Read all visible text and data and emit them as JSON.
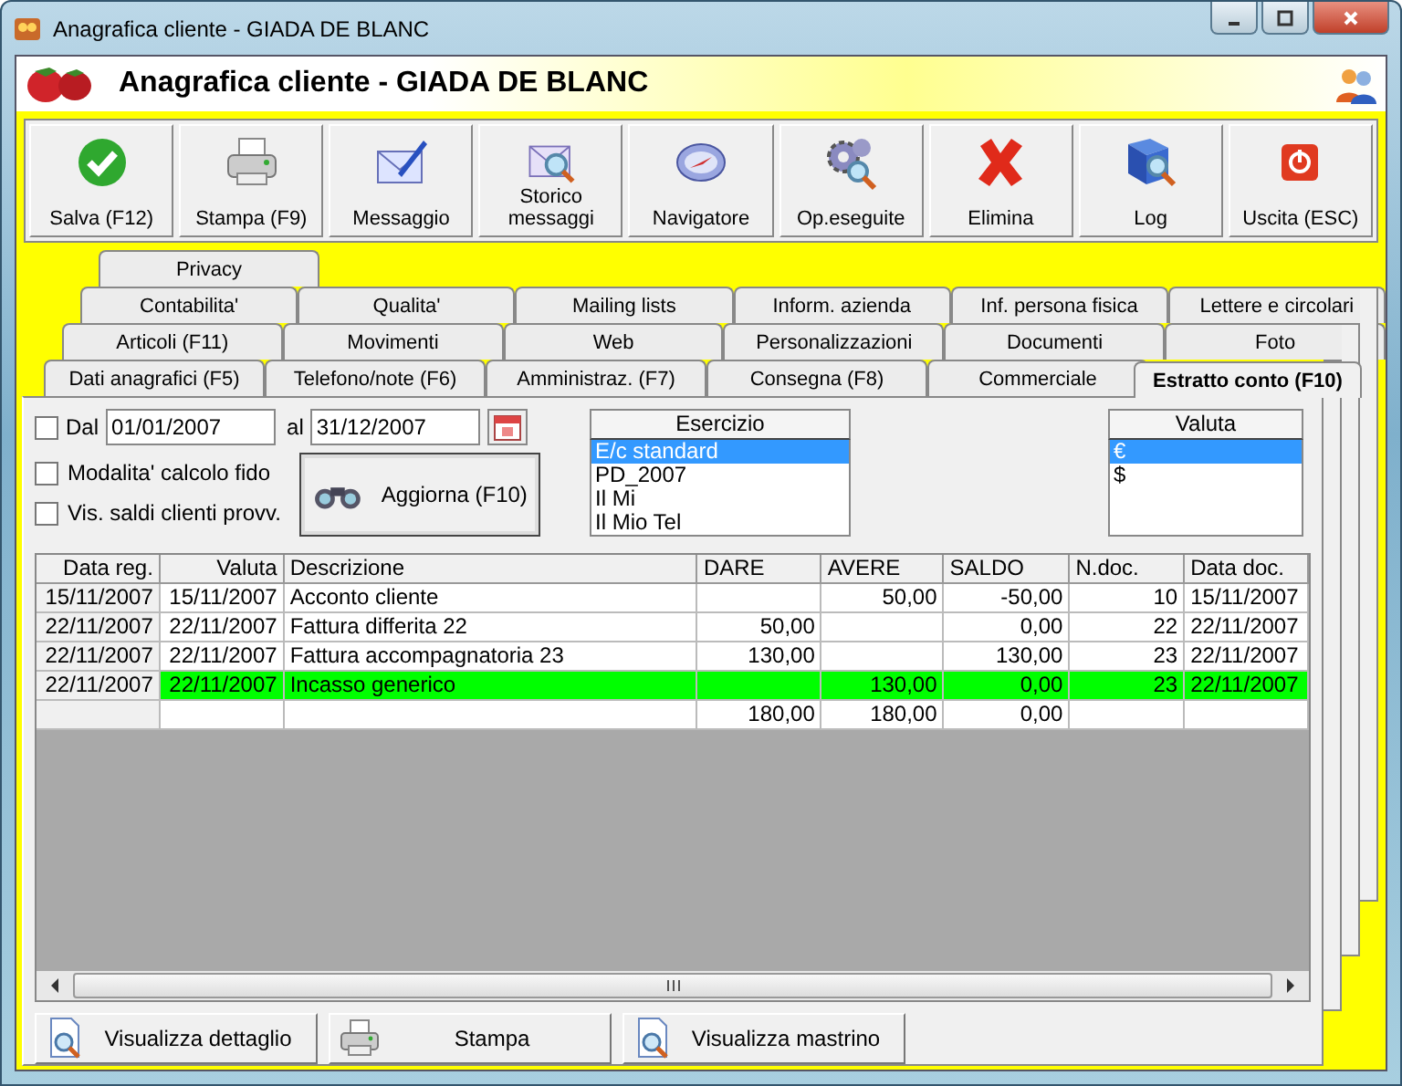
{
  "window": {
    "title": "Anagrafica cliente - GIADA DE BLANC"
  },
  "header": {
    "title": "Anagrafica cliente - GIADA DE BLANC"
  },
  "toolbar": [
    {
      "label": "Salva (F12)"
    },
    {
      "label": "Stampa (F9)"
    },
    {
      "label": "Messaggio"
    },
    {
      "label": "Storico messaggi"
    },
    {
      "label": "Navigatore"
    },
    {
      "label": "Op.eseguite"
    },
    {
      "label": "Elimina"
    },
    {
      "label": "Log"
    },
    {
      "label": "Uscita (ESC)"
    }
  ],
  "tab_rows": [
    [
      {
        "label": "Privacy",
        "selected": false
      }
    ],
    [
      {
        "label": "Contabilita'",
        "selected": false
      },
      {
        "label": "Qualita'",
        "selected": false
      },
      {
        "label": "Mailing lists",
        "selected": false
      },
      {
        "label": "Inform. azienda",
        "selected": false
      },
      {
        "label": "Inf. persona fisica",
        "selected": false
      },
      {
        "label": "Lettere e circolari",
        "selected": false
      }
    ],
    [
      {
        "label": "Articoli (F11)",
        "selected": false
      },
      {
        "label": "Movimenti",
        "selected": false
      },
      {
        "label": "Web",
        "selected": false
      },
      {
        "label": "Personalizzazioni",
        "selected": false
      },
      {
        "label": "Documenti",
        "selected": false
      },
      {
        "label": "Foto",
        "selected": false
      }
    ],
    [
      {
        "label": "Dati anagrafici (F5)",
        "selected": false
      },
      {
        "label": "Telefono/note (F6)",
        "selected": false
      },
      {
        "label": "Amministraz. (F7)",
        "selected": false
      },
      {
        "label": "Consegna (F8)",
        "selected": false
      },
      {
        "label": "Commerciale",
        "selected": false
      },
      {
        "label": "Estratto conto (F10)",
        "selected": true
      }
    ]
  ],
  "filters": {
    "from": {
      "label": "Dal",
      "checked": false,
      "value": "01/01/2007"
    },
    "to": {
      "label": "al",
      "value": "31/12/2007"
    },
    "options": [
      {
        "label": "Modalita' calcolo fido",
        "checked": false
      },
      {
        "label": "Vis. saldi clienti provv.",
        "checked": false
      }
    ],
    "refresh_button": "Aggiorna (F10)"
  },
  "esercizio": {
    "header": "Esercizio",
    "items": [
      {
        "label": "E/c standard",
        "selected": true
      },
      {
        "label": "PD_2007",
        "selected": false
      },
      {
        "label": "Il Mi",
        "selected": false
      },
      {
        "label": "Il Mio Tel",
        "selected": false
      }
    ]
  },
  "valuta": {
    "header": "Valuta",
    "items": [
      {
        "label": "€",
        "selected": true
      },
      {
        "label": "$",
        "selected": false
      }
    ]
  },
  "table": {
    "columns": [
      "Data reg.",
      "Valuta",
      "Descrizione",
      "DARE",
      "AVERE",
      "SALDO",
      "N.doc.",
      "Data doc."
    ],
    "rows": [
      {
        "cells": [
          "15/11/2007",
          "15/11/2007",
          "Acconto cliente",
          null,
          "50,00",
          "-50,00",
          "10",
          "15/11/2007"
        ],
        "highlighted": false
      },
      {
        "cells": [
          "22/11/2007",
          "22/11/2007",
          "Fattura differita 22",
          "50,00",
          null,
          "0,00",
          "22",
          "22/11/2007"
        ],
        "highlighted": false
      },
      {
        "cells": [
          "22/11/2007",
          "22/11/2007",
          "Fattura accompagnatoria 23",
          "130,00",
          null,
          "130,00",
          "23",
          "22/11/2007"
        ],
        "highlighted": false
      },
      {
        "cells": [
          "22/11/2007",
          "22/11/2007",
          "Incasso generico",
          null,
          "130,00",
          "0,00",
          "23",
          "22/11/2007"
        ],
        "highlighted": true
      }
    ],
    "totals": {
      "dare": "180,00",
      "avere": "180,00",
      "saldo": "0,00"
    }
  },
  "bottom_buttons": [
    {
      "label": "Visualizza dettaglio"
    },
    {
      "label": "Stampa"
    },
    {
      "label": "Visualizza mastrino"
    }
  ]
}
